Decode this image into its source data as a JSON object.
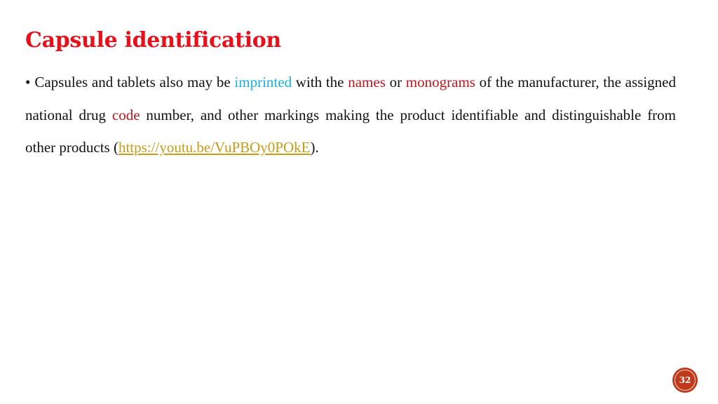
{
  "slide": {
    "title": "Capsule identification",
    "bullet_symbol": "•",
    "paragraph": {
      "segments": [
        {
          "text": "Capsules and tablets also may be ",
          "style": "normal"
        },
        {
          "text": "imprinted",
          "style": "blue"
        },
        {
          "text": " with the ",
          "style": "normal"
        },
        {
          "text": "names",
          "style": "red"
        },
        {
          "text": " or ",
          "style": "normal"
        },
        {
          "text": "monograms",
          "style": "red"
        },
        {
          "text": " of the manufacturer, the assigned national drug ",
          "style": "normal"
        },
        {
          "text": "code",
          "style": "red"
        },
        {
          "text": " number, and other markings making the product identifiable and distinguishable from other products (",
          "style": "normal"
        },
        {
          "text": "https://youtu.be/VuPBOy0POkE",
          "style": "link"
        },
        {
          "text": ").",
          "style": "normal"
        }
      ]
    },
    "page_number": "32"
  },
  "colors": {
    "title": "#e8101a",
    "highlight_blue": "#1aaee0",
    "highlight_red": "#c0151d",
    "link": "#c99a13",
    "page_badge": "#c0391b"
  }
}
